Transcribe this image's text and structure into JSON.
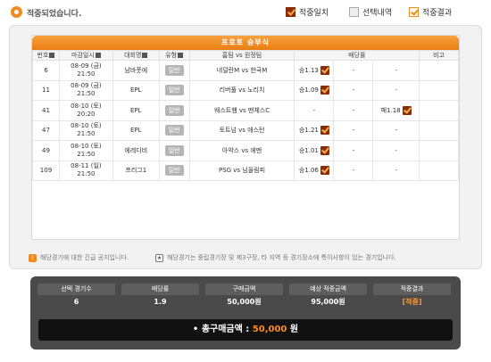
{
  "header": {
    "title": "적중되었습니다.",
    "legend": [
      {
        "label": "적중일치"
      },
      {
        "label": "선택내역"
      },
      {
        "label": "적중결과"
      }
    ]
  },
  "table": {
    "title": "프로토 승부식",
    "columns": [
      "번호",
      "마감일시",
      "대회명",
      "유형",
      "홈팀 vs 원정팀",
      "배당률",
      "비고"
    ],
    "rows": [
      {
        "no": "6",
        "date": "08-09 (금)",
        "time": "21:50",
        "league": "남바풋에",
        "type": "일반",
        "match": "네덜란M vs 한국M",
        "odds1": "승1.13",
        "odds2": "-",
        "odds3": "-"
      },
      {
        "no": "11",
        "date": "08-09 (금)",
        "time": "21:50",
        "league": "EPL",
        "type": "일반",
        "match": "리버풀 vs 노리치",
        "odds1": "승1.09",
        "odds2": "-",
        "odds3": "-"
      },
      {
        "no": "41",
        "date": "08-10 (토)",
        "time": "20:20",
        "league": "EPL",
        "type": "일반",
        "match": "웨스트햄 vs 맨체스C",
        "odds1": "-",
        "odds2": "-",
        "odds3": "패1.18"
      },
      {
        "no": "47",
        "date": "08-10 (토)",
        "time": "21:50",
        "league": "EPL",
        "type": "일반",
        "match": "토트넘 vs 애스턴",
        "odds1": "승1.21",
        "odds2": "-",
        "odds3": "-"
      },
      {
        "no": "49",
        "date": "08-10 (토)",
        "time": "21:50",
        "league": "에레디비",
        "type": "일반",
        "match": "아약스 vs 에멘",
        "odds1": "승1.01",
        "odds2": "-",
        "odds3": "-"
      },
      {
        "no": "109",
        "date": "08-11 (일)",
        "time": "21:50",
        "league": "프리그1",
        "type": "일반",
        "match": "PSG vs 님올림피",
        "odds1": "승1.06",
        "odds2": "-",
        "odds3": "-"
      }
    ]
  },
  "notes": {
    "note1": "해당경기에 대한 긴급 공지입니다.",
    "note2": "해당경기는 중립경기장 및 제3구장, 타 지역 등 경기장소에 특이사항이 있는 경기입니다."
  },
  "summary": {
    "headers": [
      "선택 경기수",
      "배당률",
      "구매금액",
      "예상 적중금액",
      "적중결과"
    ],
    "values": [
      "6",
      "1.9",
      "50,000원",
      "95,000원",
      "[적중]"
    ],
    "total_label": "총구매금액 :",
    "total_amount": "50,000",
    "total_unit": "원"
  },
  "colors": {
    "accent": "#f08c1e",
    "check": "#8a2d07",
    "summary_bg": "#4a4a4a"
  }
}
